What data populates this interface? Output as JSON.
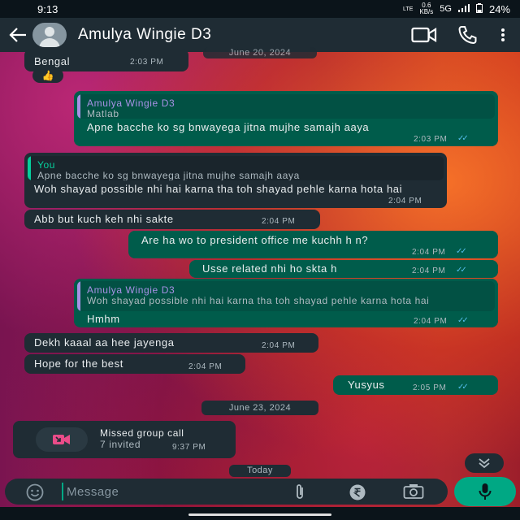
{
  "status_bar": {
    "time": "9:13",
    "lte": "LTE",
    "speed_value": "0.6",
    "speed_unit": "KB/s",
    "network": "5G",
    "battery": "24%"
  },
  "header": {
    "contact_name": "Amulya Wingie D3",
    "icons": [
      "back-arrow-icon",
      "avatar",
      "video-call-icon",
      "voice-call-icon",
      "more-options-icon"
    ]
  },
  "messages": [
    {
      "id": "m1",
      "direction": "in",
      "text": "Bengal",
      "time": "2:03 PM",
      "reaction": "👍"
    },
    {
      "id": "m2",
      "direction": "out",
      "quote_author": "Amulya Wingie D3",
      "quote_text": "Matlab",
      "text": "Apne bacche ko sg bnwayega jitna mujhe samajh aaya",
      "time": "2:03 PM",
      "ticks": "✓✓"
    },
    {
      "id": "m3",
      "direction": "in",
      "quote_author": "You",
      "quote_text": "Apne bacche ko sg bnwayega jitna mujhe samajh aaya",
      "text": "Woh shayad possible nhi hai karna tha toh shayad pehle karna hota hai",
      "time": "2:04 PM"
    },
    {
      "id": "m4",
      "direction": "in",
      "text": "Abb but kuch keh nhi sakte",
      "time": "2:04 PM"
    },
    {
      "id": "m5",
      "direction": "out",
      "text": "Are ha wo to president office me kuchh h n?",
      "time": "2:04 PM",
      "ticks": "✓✓"
    },
    {
      "id": "m6",
      "direction": "out",
      "text": "Usse related nhi ho skta h",
      "time": "2:04 PM",
      "ticks": "✓✓"
    },
    {
      "id": "m7",
      "direction": "out",
      "quote_author": "Amulya Wingie D3",
      "quote_text": "Woh shayad possible nhi hai karna tha toh shayad pehle karna hota hai",
      "text": "Hmhm",
      "time": "2:04 PM",
      "ticks": "✓✓"
    },
    {
      "id": "m8",
      "direction": "in",
      "text": "Dekh kaaal aa hee jayenga",
      "time": "2:04 PM"
    },
    {
      "id": "m9",
      "direction": "in",
      "text": "Hope for the best",
      "time": "2:04 PM"
    },
    {
      "id": "m10",
      "direction": "out",
      "text": "Yusyus",
      "time": "2:05 PM",
      "ticks": "✓✓"
    },
    {
      "id": "m11",
      "direction": "in",
      "type": "missed-call",
      "title": "Missed group call",
      "subtitle": "7 invited",
      "time": "9:37 PM"
    }
  ],
  "date_chips": {
    "top": "June 20, 2024",
    "middle": "June 23, 2024",
    "bottom": "Today"
  },
  "input": {
    "placeholder": "Message",
    "icons": [
      "emoji-icon",
      "attach-icon",
      "rupee-payment-icon",
      "camera-icon",
      "mic-icon"
    ]
  },
  "colors": {
    "incoming_bubble": "#1f2c34",
    "outgoing_bubble": "#005c4b",
    "accent": "#00a884",
    "read_ticks": "#53bdeb"
  }
}
